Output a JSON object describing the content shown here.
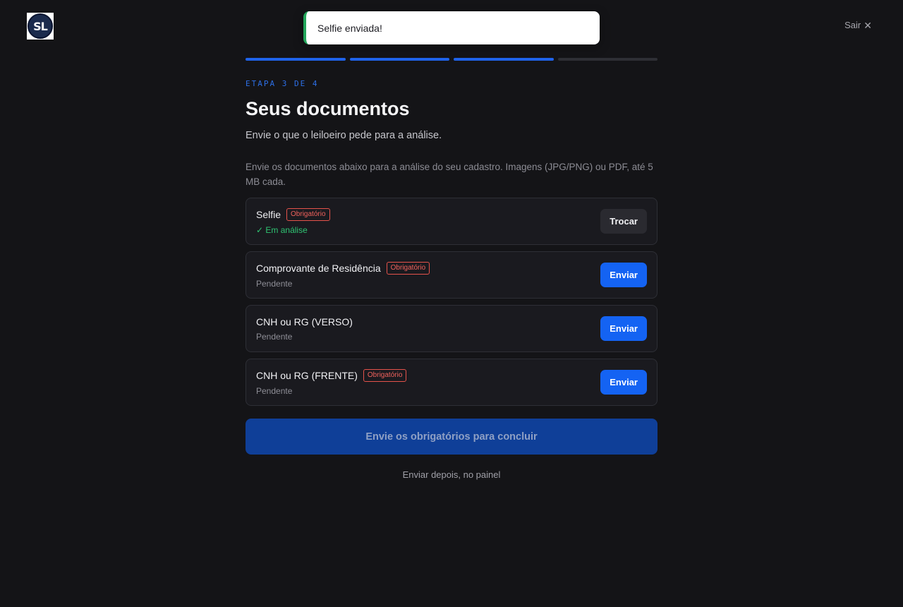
{
  "app": {
    "logo_text": "SL"
  },
  "header": {
    "exit_label": "Sair",
    "exit_icon": "close-icon"
  },
  "toast": {
    "message": "Selfie enviada!",
    "accent_color": "#22a55a"
  },
  "progress": {
    "current_step": 3,
    "total_steps": 4
  },
  "step": {
    "label": "ETAPA 3 DE 4",
    "title": "Seus documentos",
    "subtitle": "Envie o que o leiloeiro pede para a análise.",
    "info": "Envie os documentos abaixo para a análise do seu cadastro. Imagens (JPG/PNG) ou PDF, até 5 MB cada."
  },
  "documents": [
    {
      "name": "Selfie",
      "badge": "Obrigatório",
      "status": "✓ Em análise",
      "action": "Trocar"
    },
    {
      "name": "Comprovante de Residência",
      "badge": "Obrigatório",
      "status": "Pendente",
      "action": "Enviar"
    },
    {
      "name": "CNH ou RG (VERSO)",
      "badge": "",
      "status": "Pendente",
      "action": "Enviar"
    },
    {
      "name": "CNH ou RG (FRENTE)",
      "badge": "Obrigatório",
      "status": "Pendente",
      "action": "Enviar"
    }
  ],
  "actions": {
    "submit_label": "Envie os obrigatórios para concluir",
    "later_label": "Enviar depois, no painel"
  },
  "colors": {
    "background": "#141417",
    "accent": "#1463f3",
    "required": "#e5534b",
    "success": "#2fc472"
  }
}
